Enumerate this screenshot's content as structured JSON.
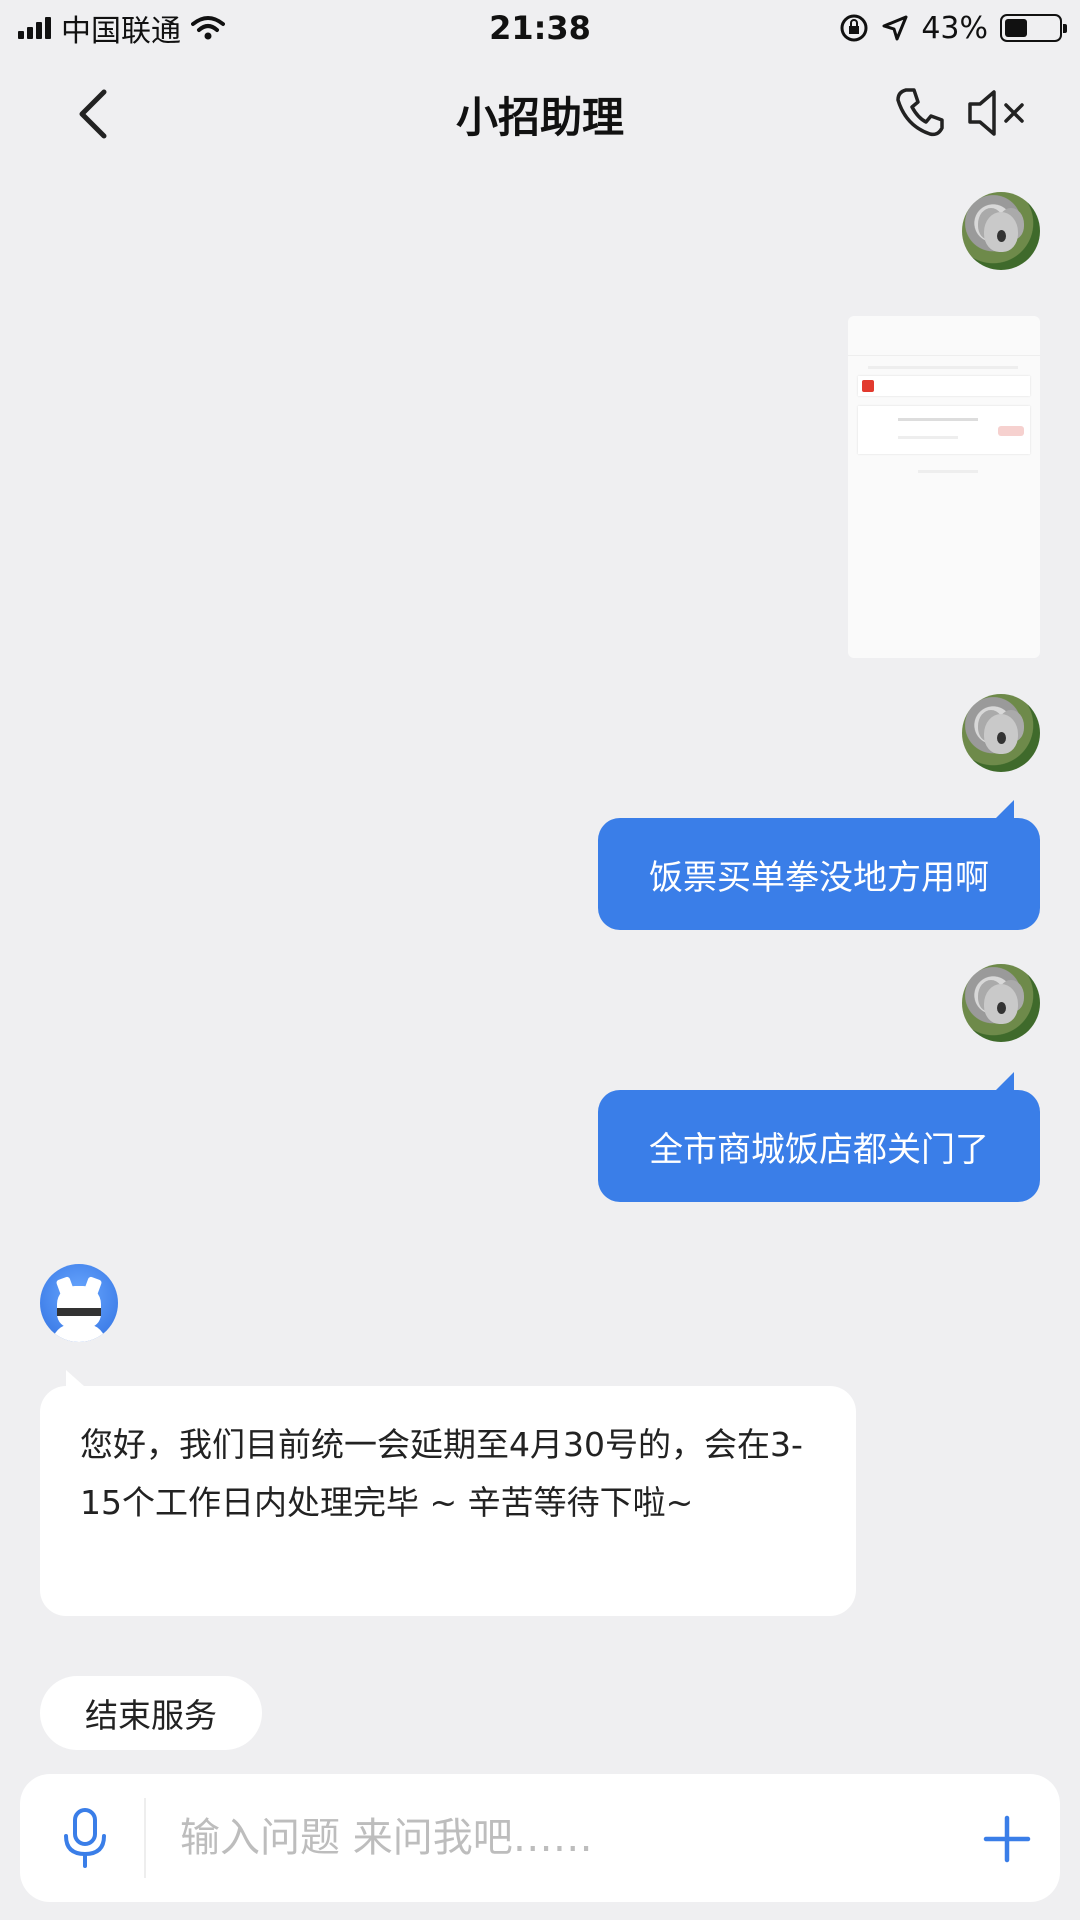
{
  "status_bar": {
    "carrier": "中国联通",
    "time": "21:38",
    "battery_percent": "43%",
    "battery_level": 0.43
  },
  "header": {
    "title": "小招助理"
  },
  "messages": {
    "user_msg_1": "饭票买单拳没地方用啊",
    "user_msg_2": "全市商城饭店都关门了",
    "bot_reply": "您好，我们目前统一会延期至4月30号的，会在3-15个工作日内处理完毕 ~ 辛苦等待下啦~"
  },
  "actions": {
    "end_service": "结束服务"
  },
  "input": {
    "placeholder": "输入问题 来问我吧……"
  },
  "colors": {
    "accent": "#3a7ee8",
    "background": "#efeff1"
  }
}
